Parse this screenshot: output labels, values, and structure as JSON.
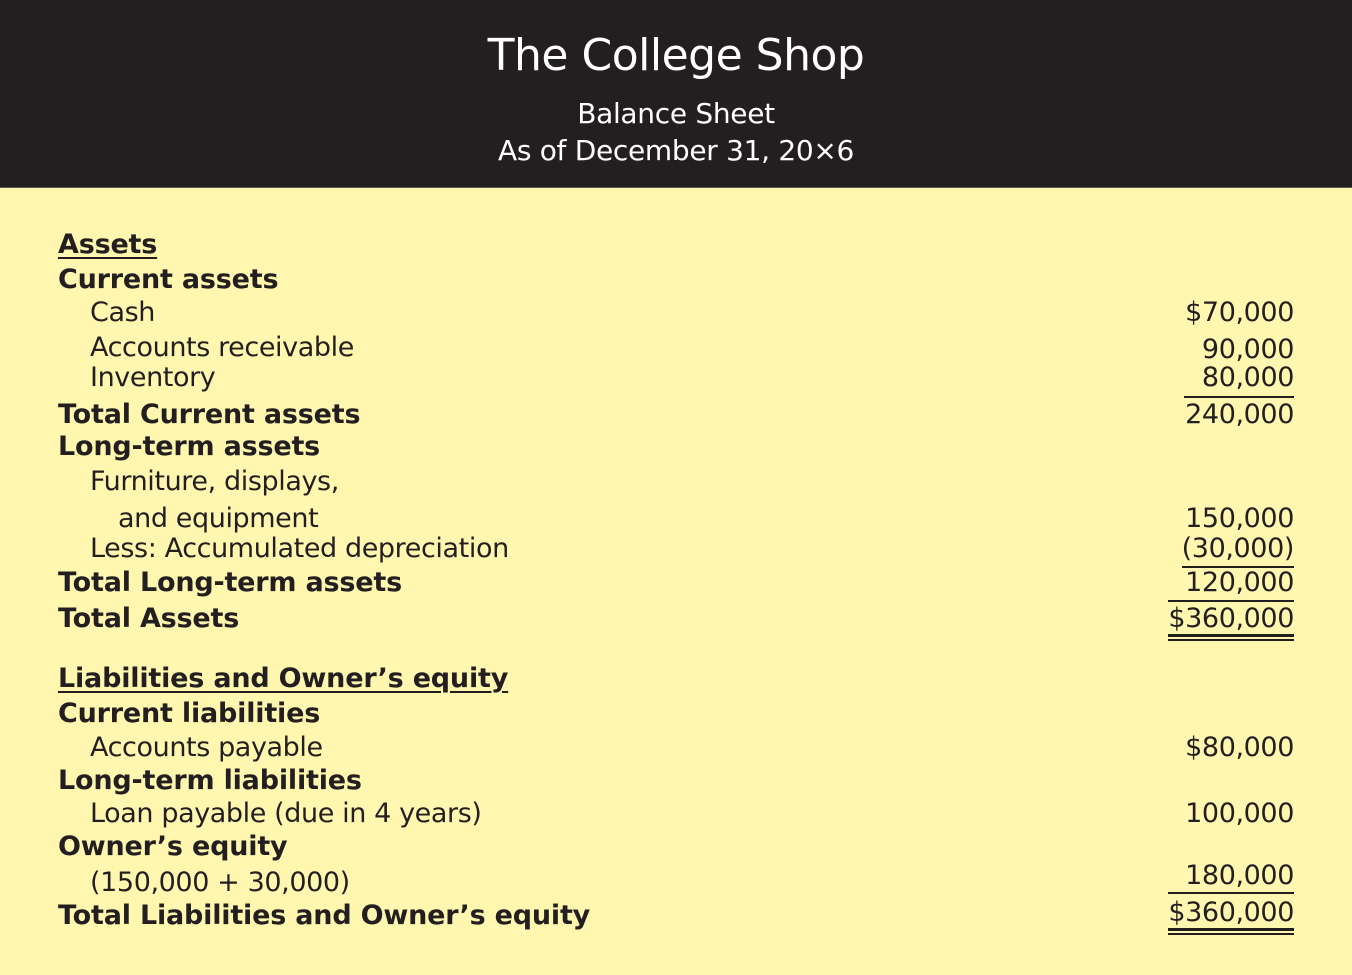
{
  "header": {
    "title": "The College Shop",
    "subtitle": "Balance Sheet",
    "date": "As of December 31, 20×6"
  },
  "assets": {
    "heading": "Assets",
    "current": {
      "heading": "Current assets",
      "items": [
        {
          "label": "Cash",
          "amount": "$70,000"
        },
        {
          "label": "Accounts receivable",
          "amount": "90,000"
        },
        {
          "label": "Inventory",
          "amount": "80,000"
        }
      ],
      "total_label": "Total Current assets",
      "total_amount": "240,000"
    },
    "long_term": {
      "heading": "Long-term assets",
      "items": [
        {
          "label": "Furniture, displays,",
          "label_cont": "and equipment",
          "amount": "150,000"
        },
        {
          "label": "Less: Accumulated depreciation",
          "amount": "(30,000)"
        }
      ],
      "total_label": "Total Long-term assets",
      "total_amount": "120,000"
    },
    "total_label": "Total Assets",
    "total_amount": "$360,000"
  },
  "liabilities_equity": {
    "heading": "Liabilities and Owner’s equity",
    "current": {
      "heading": "Current liabilities",
      "items": [
        {
          "label": "Accounts payable",
          "amount": "$80,000"
        }
      ]
    },
    "long_term": {
      "heading": "Long-term liabilities",
      "items": [
        {
          "label": "Loan payable (due in 4 years)",
          "amount": "100,000"
        }
      ]
    },
    "equity": {
      "heading": "Owner’s equity",
      "items": [
        {
          "label": "(150,000 + 30,000)",
          "amount": "180,000"
        }
      ]
    },
    "total_label": "Total Liabilities and Owner’s equity",
    "total_amount": "$360,000"
  }
}
